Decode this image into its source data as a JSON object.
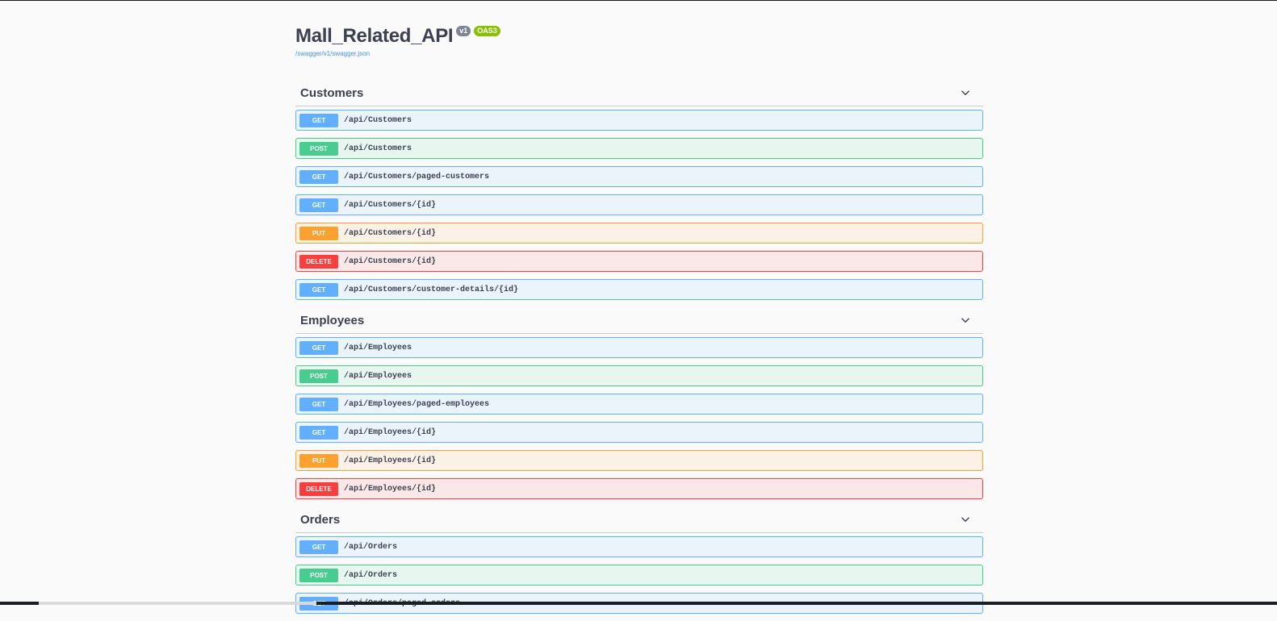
{
  "info": {
    "title": "Mall_Related_API",
    "version": "v1",
    "oas": "OAS3",
    "spec_link": "/swagger/v1/swagger.json"
  },
  "sections": [
    {
      "name": "Customers",
      "operations": [
        {
          "method": "GET",
          "path": "/api/Customers"
        },
        {
          "method": "POST",
          "path": "/api/Customers"
        },
        {
          "method": "GET",
          "path": "/api/Customers/paged-customers"
        },
        {
          "method": "GET",
          "path": "/api/Customers/{id}"
        },
        {
          "method": "PUT",
          "path": "/api/Customers/{id}"
        },
        {
          "method": "DELETE",
          "path": "/api/Customers/{id}"
        },
        {
          "method": "GET",
          "path": "/api/Customers/customer-details/{id}"
        }
      ]
    },
    {
      "name": "Employees",
      "operations": [
        {
          "method": "GET",
          "path": "/api/Employees"
        },
        {
          "method": "POST",
          "path": "/api/Employees"
        },
        {
          "method": "GET",
          "path": "/api/Employees/paged-employees"
        },
        {
          "method": "GET",
          "path": "/api/Employees/{id}"
        },
        {
          "method": "PUT",
          "path": "/api/Employees/{id}"
        },
        {
          "method": "DELETE",
          "path": "/api/Employees/{id}"
        }
      ]
    },
    {
      "name": "Orders",
      "operations": [
        {
          "method": "GET",
          "path": "/api/Orders"
        },
        {
          "method": "POST",
          "path": "/api/Orders"
        },
        {
          "method": "GET",
          "path": "/api/Orders/paged-orders"
        }
      ]
    }
  ],
  "icons": {
    "section_toggle": "chevron-down-icon"
  }
}
